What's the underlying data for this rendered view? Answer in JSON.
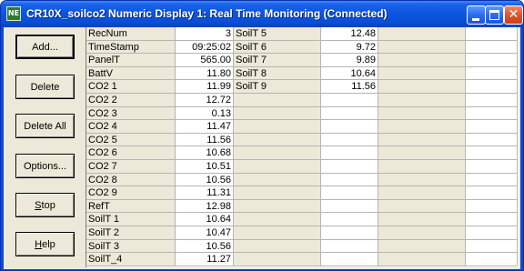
{
  "window": {
    "title": "CR10X_soilco2 Numeric Display 1: Real Time Monitoring (Connected)",
    "icon_label": "NE"
  },
  "buttons": {
    "add": "Add...",
    "delete": "Delete",
    "delete_all": "Delete All",
    "options": "Options...",
    "stop_prefix": "",
    "stop_underlined": "S",
    "stop_rest": "top",
    "help_prefix": "",
    "help_underlined": "H",
    "help_rest": "elp"
  },
  "table": {
    "column1": [
      {
        "name": "RecNum",
        "value": "3"
      },
      {
        "name": "TimeStamp",
        "value": "09:25:02"
      },
      {
        "name": "PanelT",
        "value": "565.00"
      },
      {
        "name": "BattV",
        "value": "11.80"
      },
      {
        "name": "CO2  1",
        "value": "11.99"
      },
      {
        "name": "CO2  2",
        "value": "12.72"
      },
      {
        "name": "CO2  3",
        "value": "0.13"
      },
      {
        "name": "CO2  4",
        "value": "11.47"
      },
      {
        "name": "CO2  5",
        "value": "11.56"
      },
      {
        "name": "CO2  6",
        "value": "10.68"
      },
      {
        "name": "CO2  7",
        "value": "10.51"
      },
      {
        "name": "CO2  8",
        "value": "10.56"
      },
      {
        "name": "CO2  9",
        "value": "11.31"
      },
      {
        "name": "RefT",
        "value": "12.98"
      },
      {
        "name": "SoilT  1",
        "value": "10.64"
      },
      {
        "name": "SoilT  2",
        "value": "10.47"
      },
      {
        "name": "SoilT  3",
        "value": "10.56"
      },
      {
        "name": "SoilT_4",
        "value": "11.27"
      }
    ],
    "column2": [
      {
        "name": "SoilT  5",
        "value": "12.48"
      },
      {
        "name": "SoilT  6",
        "value": "9.72"
      },
      {
        "name": "SoilT  7",
        "value": "9.89"
      },
      {
        "name": "SoilT  8",
        "value": "10.64"
      },
      {
        "name": "SoilT  9",
        "value": "11.56"
      }
    ]
  }
}
